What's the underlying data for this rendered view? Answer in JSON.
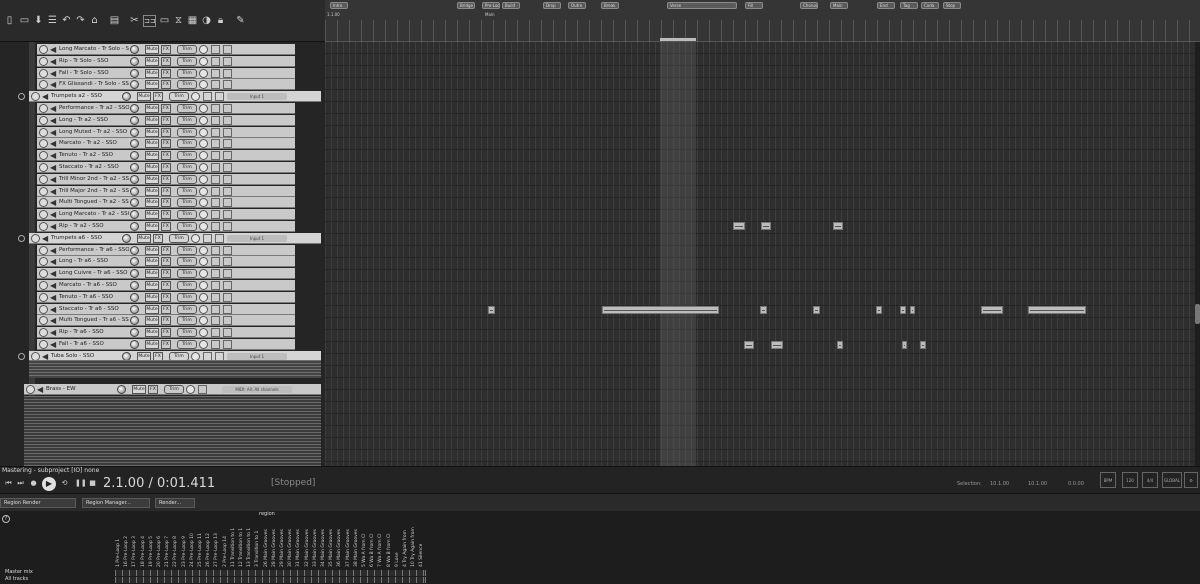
{
  "colors": {
    "bg": "#1f1f1f",
    "track": "#c9c9c9",
    "item": "#bcbcbc"
  },
  "toolbar": {
    "icons": [
      "undo-icon",
      "redo-icon",
      "home-icon",
      "snap-icon",
      "ripple-icon",
      "grid-icon",
      "lock-icon"
    ]
  },
  "tracks": [
    {
      "name": "Long Marcato - Tr Solo - SSO",
      "mute": "Mute",
      "fx": "FX",
      "env": "Trim",
      "input": ""
    },
    {
      "name": "Rip - Tr Solo - SSO",
      "mute": "Mute",
      "fx": "FX",
      "env": "Trim",
      "input": ""
    },
    {
      "name": "Fall - Tr Solo - SSO",
      "mute": "Mute",
      "fx": "FX",
      "env": "Trim",
      "input": ""
    },
    {
      "name": "FX Glissandi - Tr Solo - SSO",
      "mute": "Mute",
      "fx": "FX",
      "env": "Trim",
      "input": ""
    },
    {
      "name": "Trumpets a2 - SSO",
      "mute": "Mute",
      "fx": "FX",
      "env": "Trim",
      "input": "Input 1",
      "folder": true
    },
    {
      "name": "Performance - Tr a2 - SSO",
      "mute": "Mute",
      "fx": "FX",
      "env": "Trim",
      "input": ""
    },
    {
      "name": "Long - Tr a2 - SSO",
      "mute": "Mute",
      "fx": "FX",
      "env": "Trim",
      "input": ""
    },
    {
      "name": "Long Muted - Tr a2 - SSO",
      "mute": "Mute",
      "fx": "FX",
      "env": "Trim",
      "input": ""
    },
    {
      "name": "Marcato - Tr a2 - SSO",
      "mute": "Mute",
      "fx": "FX",
      "env": "Trim",
      "input": ""
    },
    {
      "name": "Tenuto - Tr a2 - SSO",
      "mute": "Mute",
      "fx": "FX",
      "env": "Trim",
      "input": ""
    },
    {
      "name": "Staccato - Tr a2 - SSO",
      "mute": "Mute",
      "fx": "FX",
      "env": "Trim",
      "input": ""
    },
    {
      "name": "Trill Minor 2nd - Tr a2 - SSO",
      "mute": "Mute",
      "fx": "FX",
      "env": "Trim",
      "input": ""
    },
    {
      "name": "Trill Major 2nd - Tr a2 - SSO",
      "mute": "Mute",
      "fx": "FX",
      "env": "Trim",
      "input": ""
    },
    {
      "name": "Multi Tongued - Tr a2 - SSO",
      "mute": "Mute",
      "fx": "FX",
      "env": "Trim",
      "input": ""
    },
    {
      "name": "Long Marcato - Tr a2 - SSO",
      "mute": "Mute",
      "fx": "FX",
      "env": "Trim",
      "input": ""
    },
    {
      "name": "Rip - Tr a2 - SSO",
      "mute": "Mute",
      "fx": "FX",
      "env": "Trim",
      "input": ""
    },
    {
      "name": "Trumpets a6 - SSO",
      "mute": "Mute",
      "fx": "FX",
      "env": "Trim",
      "input": "Input 1",
      "folder": true
    },
    {
      "name": "Performance - Tr a6 - SSO",
      "mute": "Mute",
      "fx": "FX",
      "env": "Trim",
      "input": ""
    },
    {
      "name": "Long - Tr a6 - SSO",
      "mute": "Mute",
      "fx": "FX",
      "env": "Trim",
      "input": ""
    },
    {
      "name": "Long Cuivre - Tr a6 - SSO",
      "mute": "Mute",
      "fx": "FX",
      "env": "Trim",
      "input": ""
    },
    {
      "name": "Marcato - Tr a6 - SSO",
      "mute": "Mute",
      "fx": "FX",
      "env": "Trim",
      "input": ""
    },
    {
      "name": "Tenuto - Tr a6 - SSO",
      "mute": "Mute",
      "fx": "FX",
      "env": "Trim",
      "input": ""
    },
    {
      "name": "Staccato - Tr a6 - SSO",
      "mute": "Mute",
      "fx": "FX",
      "env": "Trim",
      "input": ""
    },
    {
      "name": "Multi Tongued - Tr a6 - SSO",
      "mute": "Mute",
      "fx": "FX",
      "env": "Trim",
      "input": ""
    },
    {
      "name": "Rip - Tr a6 - SSO",
      "mute": "Mute",
      "fx": "FX",
      "env": "Trim",
      "input": ""
    },
    {
      "name": "Fall - Tr a6 - SSO",
      "mute": "Mute",
      "fx": "FX",
      "env": "Trim",
      "input": ""
    },
    {
      "name": "Tuba Solo - SSO",
      "mute": "Mute",
      "fx": "FX",
      "env": "Trim",
      "input": "Input 1",
      "folder": true
    }
  ],
  "bus_track": {
    "name": "Brass - EW",
    "mute": "Mute",
    "fx": "FX",
    "env": "Trim",
    "input": "MIDI: All: All channels"
  },
  "markers": [
    "Intro",
    "Bridge",
    "Pre-Loop",
    "Build",
    "Drop",
    "Outro",
    "Break",
    "Verse",
    "Fill",
    "Chorus",
    "Main",
    "End",
    "Tag",
    "Coda",
    "Stop"
  ],
  "ruler": {
    "start": "1.1.00",
    "region_label": "Main"
  },
  "transport": {
    "project": "Mastering - subproject [IO] none",
    "time": "2.1.00 / 0:01.411",
    "state": "[Stopped]",
    "selection_label": "Selection:",
    "sel_start": "10.1.00",
    "sel_end": "10.1.00",
    "sel_len": "0.0.00",
    "bpm_label": "BPM",
    "rate": "120",
    "sig": "4/4",
    "global": "GLOBAL"
  },
  "render": {
    "region_render": "Region Render",
    "region_manager": "Region Manager...",
    "render": "Render...",
    "region_header": "region",
    "columns": [
      "Pre-Loop 1",
      "Pre-Loop 2",
      "Pre-Loop 3",
      "Pre-Loop 4",
      "Pre-Loop 5",
      "Pre-Loop 6",
      "Pre-Loop 7",
      "Pre-Loop 8",
      "Pre-Loop 9",
      "Pre-Loop 10",
      "Pre-Loop 11",
      "Pre-Loop 12",
      "Pre-Loop 13",
      "Pre-Loop 14",
      "Transition to 1",
      "Transition to 1",
      "Transition to 1",
      "Transition to 1",
      "Main Grooves",
      "Main Grooves",
      "Main Grooves",
      "Main Grooves",
      "Main Grooves",
      "Main Grooves",
      "Main Grooves",
      "Main Grooves",
      "Main Grooves",
      "Main Grooves",
      "Main Grooves",
      "Main Grooves",
      "Wa A from Cl",
      "Wa B from Cl",
      "Wa A from Cl",
      "Wa B from Cl",
      "Lose",
      "Try Again from",
      "Try Again from",
      "Silence"
    ],
    "column_numbers": [
      "1",
      "16",
      "17",
      "18",
      "19",
      "20",
      "21",
      "22",
      "23",
      "24",
      "25",
      "26",
      "27",
      "2",
      "11",
      "12",
      "13",
      "3",
      "26",
      "28",
      "29",
      "30",
      "31",
      "32",
      "33",
      "34",
      "35",
      "36",
      "37",
      "38",
      "5",
      "6",
      "7",
      "8",
      "9",
      "4",
      "10",
      "41"
    ],
    "rows": [
      "Master mix",
      "All tracks"
    ]
  }
}
